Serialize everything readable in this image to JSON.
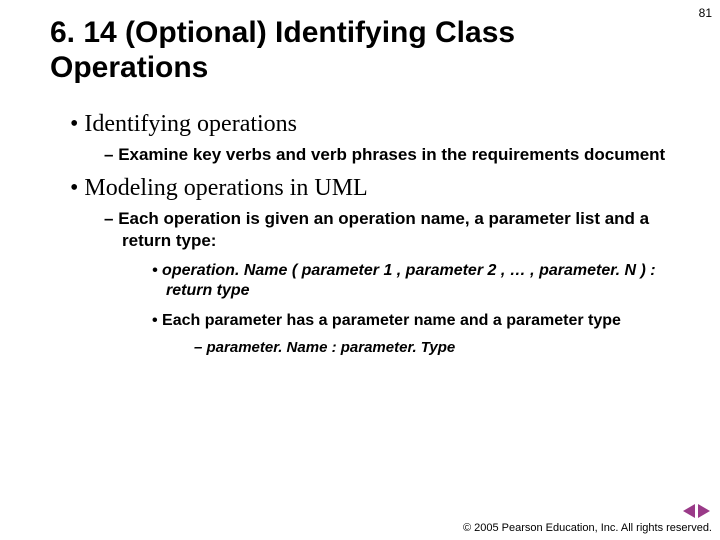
{
  "pageNumber": "81",
  "title": "6. 14 (Optional) Identifying Class Operations",
  "bullets": {
    "b1": "Identifying operations",
    "b1a": "Examine key verbs and verb phrases in the requirements document",
    "b2": "Modeling operations in UML",
    "b2a": "Each operation is given an operation name, a parameter list and a return type:",
    "b2a1": "operation. Name ( parameter 1 , parameter 2 , … , parameter. N ) : return type",
    "b2a2": "Each parameter has a parameter name and a parameter type",
    "b2a2a": "parameter. Name : parameter. Type"
  },
  "footer": "© 2005 Pearson Education, Inc. All rights reserved.",
  "nav": {
    "prev": "previous-slide",
    "next": "next-slide"
  }
}
